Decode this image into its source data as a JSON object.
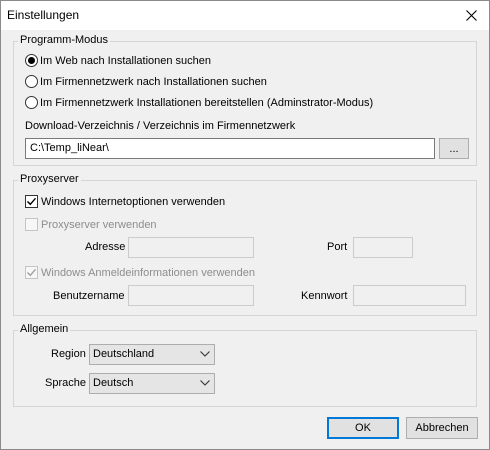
{
  "window": {
    "title": "Einstellungen"
  },
  "programm_modus": {
    "legend": "Programm-Modus",
    "options": [
      {
        "label": "Im Web nach Installationen suchen",
        "checked": true
      },
      {
        "label": "Im Firmennetzwerk nach Installationen suchen",
        "checked": false
      },
      {
        "label": "Im Firmennetzwerk Installationen bereitstellen (Adminstrator-Modus)",
        "checked": false
      }
    ],
    "download_label": "Download-Verzeichnis / Verzeichnis im Firmennetzwerk",
    "download_value": "C:\\Temp_liNear\\",
    "browse_label": "..."
  },
  "proxyserver": {
    "legend": "Proxyserver",
    "use_windows_options": {
      "label": "Windows Internetoptionen verwenden",
      "checked": true
    },
    "use_proxy": {
      "label": "Proxyserver verwenden",
      "checked": false
    },
    "address_label": "Adresse",
    "port_label": "Port",
    "use_windows_credentials": {
      "label": "Windows Anmeldeinformationen verwenden",
      "checked": true
    },
    "username_label": "Benutzername",
    "password_label": "Kennwort"
  },
  "allgemein": {
    "legend": "Allgemein",
    "region_label": "Region",
    "region_value": "Deutschland",
    "language_label": "Sprache",
    "language_value": "Deutsch"
  },
  "footer": {
    "ok_label": "OK",
    "cancel_label": "Abbrechen"
  },
  "colors": {
    "accent": "#0078d7",
    "window_bg": "#f0f0f0",
    "disabled_text": "#8d8d8d"
  }
}
